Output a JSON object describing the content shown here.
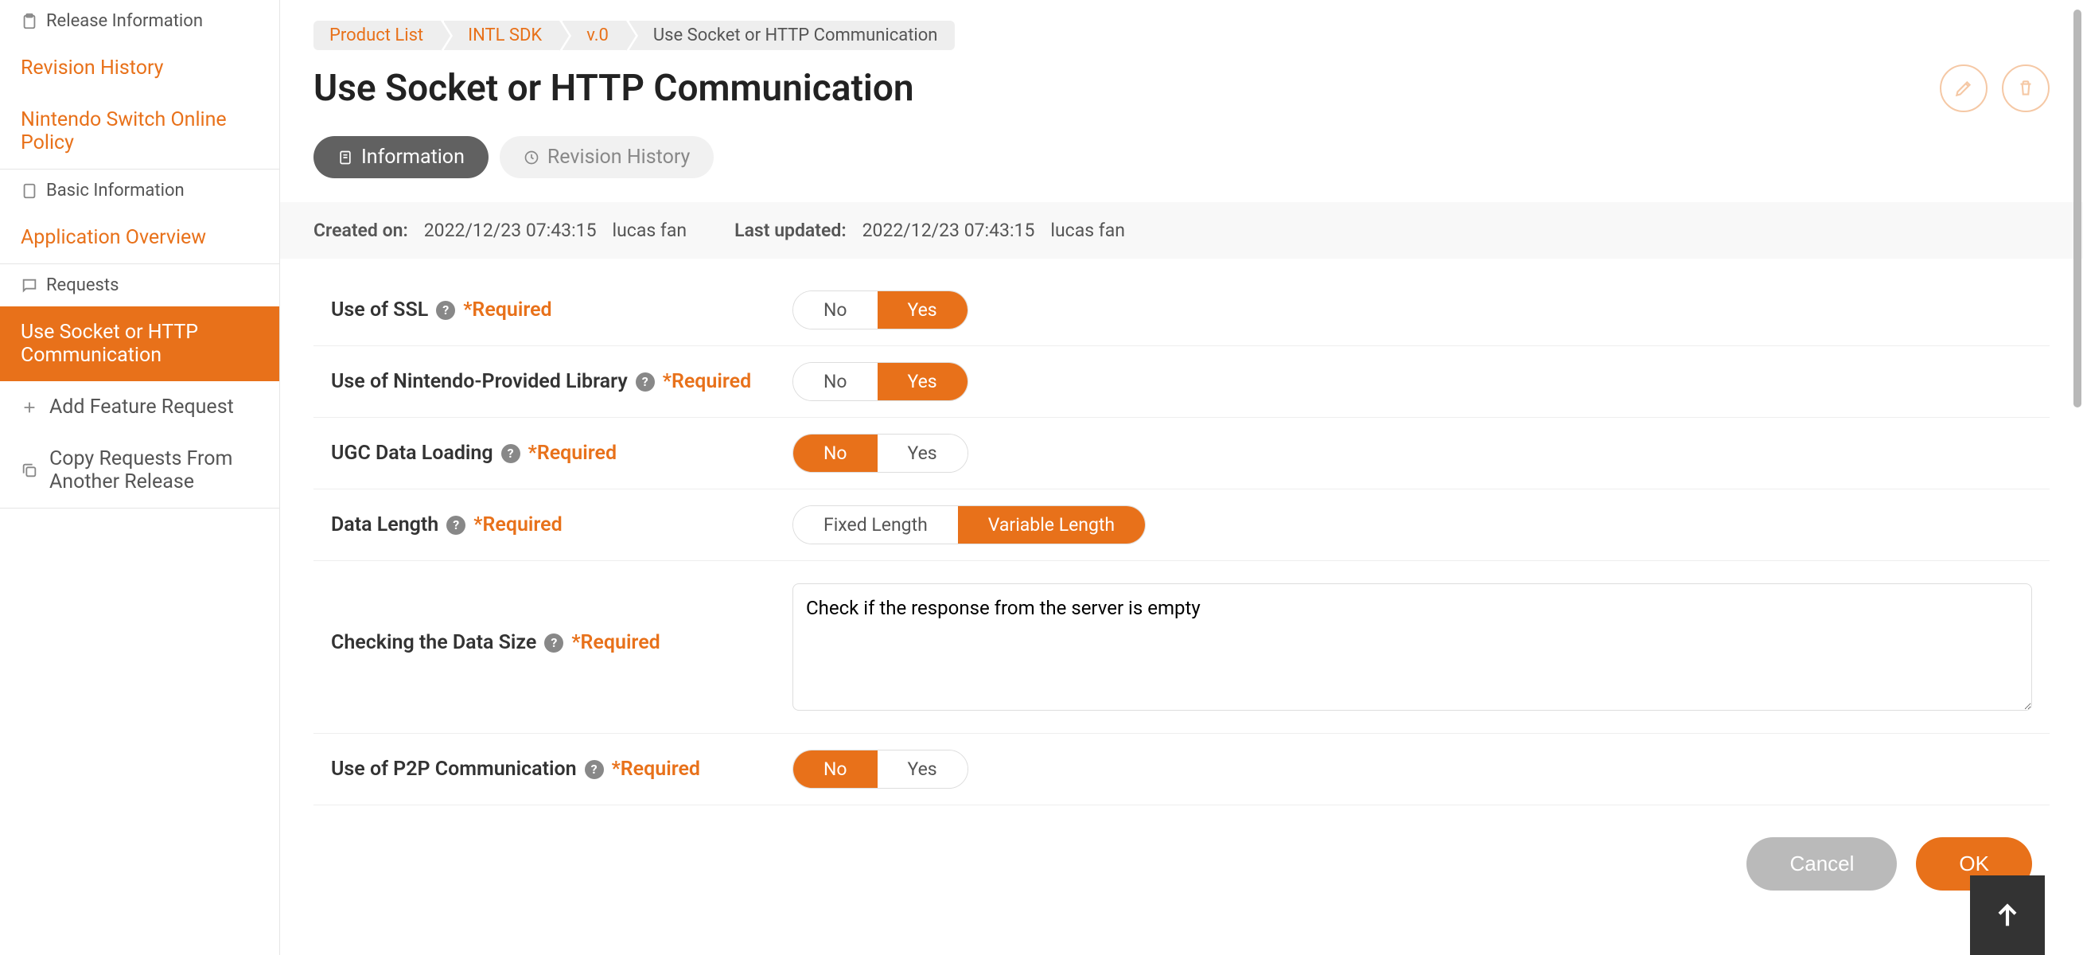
{
  "sidebar": {
    "release_info_header": "Release Information",
    "revision_history": "Revision History",
    "nso_policy": "Nintendo Switch Online Policy",
    "basic_info_header": "Basic Information",
    "app_overview": "Application Overview",
    "requests_header": "Requests",
    "use_socket": "Use Socket or HTTP Communication",
    "add_feature": "Add Feature Request",
    "copy_requests": "Copy Requests From Another Release"
  },
  "breadcrumb": {
    "product_list": "Product List",
    "intl_sdk": "INTL SDK",
    "version": "v.0",
    "current": "Use Socket or HTTP Communication"
  },
  "page_title": "Use Socket or HTTP Communication",
  "tabs": {
    "information": "Information",
    "revision_history": "Revision History"
  },
  "meta": {
    "created_label": "Created on:",
    "created_date": "2022/12/23 07:43:15",
    "created_user": "lucas fan",
    "updated_label": "Last updated:",
    "updated_date": "2022/12/23 07:43:15",
    "updated_user": "lucas fan"
  },
  "required_text": "*Required",
  "fields": {
    "ssl": {
      "label": "Use of SSL",
      "no": "No",
      "yes": "Yes"
    },
    "library": {
      "label": "Use of Nintendo-Provided Library",
      "no": "No",
      "yes": "Yes"
    },
    "ugc": {
      "label": "UGC Data Loading",
      "no": "No",
      "yes": "Yes"
    },
    "data_length": {
      "label": "Data Length",
      "fixed": "Fixed Length",
      "variable": "Variable Length"
    },
    "data_size": {
      "label": "Checking the Data Size",
      "value": "Check if the response from the server is empty"
    },
    "p2p": {
      "label": "Use of P2P Communication",
      "no": "No",
      "yes": "Yes"
    }
  },
  "buttons": {
    "cancel": "Cancel",
    "ok": "OK"
  }
}
